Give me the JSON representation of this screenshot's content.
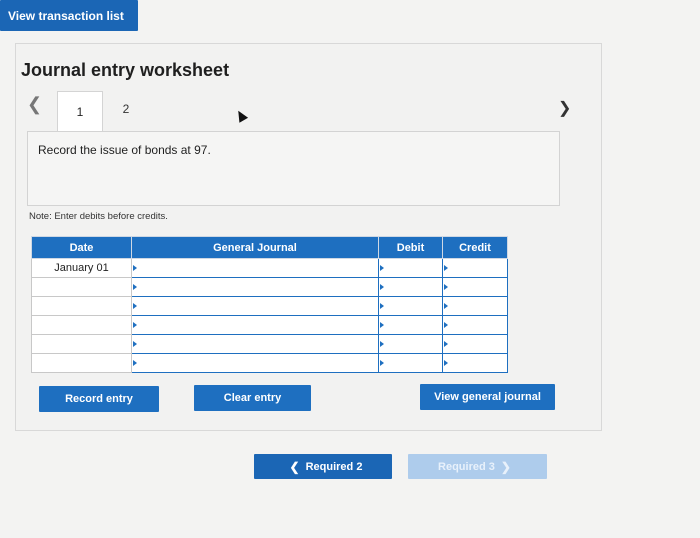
{
  "header": {
    "view_transactions_label": "View transaction list"
  },
  "worksheet": {
    "title": "Journal entry worksheet",
    "tabs": [
      {
        "label": "1",
        "active": true
      },
      {
        "label": "2",
        "active": false
      }
    ],
    "instruction": "Record the issue of bonds at 97.",
    "note": "Note: Enter debits before credits."
  },
  "table": {
    "columns": [
      "Date",
      "General Journal",
      "Debit",
      "Credit"
    ],
    "rows": [
      {
        "date": "January 01",
        "account": "",
        "debit": "",
        "credit": ""
      },
      {
        "date": "",
        "account": "",
        "debit": "",
        "credit": ""
      },
      {
        "date": "",
        "account": "",
        "debit": "",
        "credit": ""
      },
      {
        "date": "",
        "account": "",
        "debit": "",
        "credit": ""
      },
      {
        "date": "",
        "account": "",
        "debit": "",
        "credit": ""
      },
      {
        "date": "",
        "account": "",
        "debit": "",
        "credit": ""
      }
    ]
  },
  "actions": {
    "record_entry": "Record entry",
    "clear_entry": "Clear entry",
    "view_general_journal": "View general journal"
  },
  "pager": {
    "prev_label": "Required 2",
    "next_label": "Required 3"
  },
  "icons": {
    "prev": "chevron-left-icon",
    "next": "chevron-right-icon",
    "entry_marker": "triangle-right-icon",
    "cursor": "mouse-pointer-icon"
  },
  "colors": {
    "primary": "#1e6fc0",
    "primary_disabled": "#aeccec",
    "panel_background": "#f2f2f1"
  }
}
